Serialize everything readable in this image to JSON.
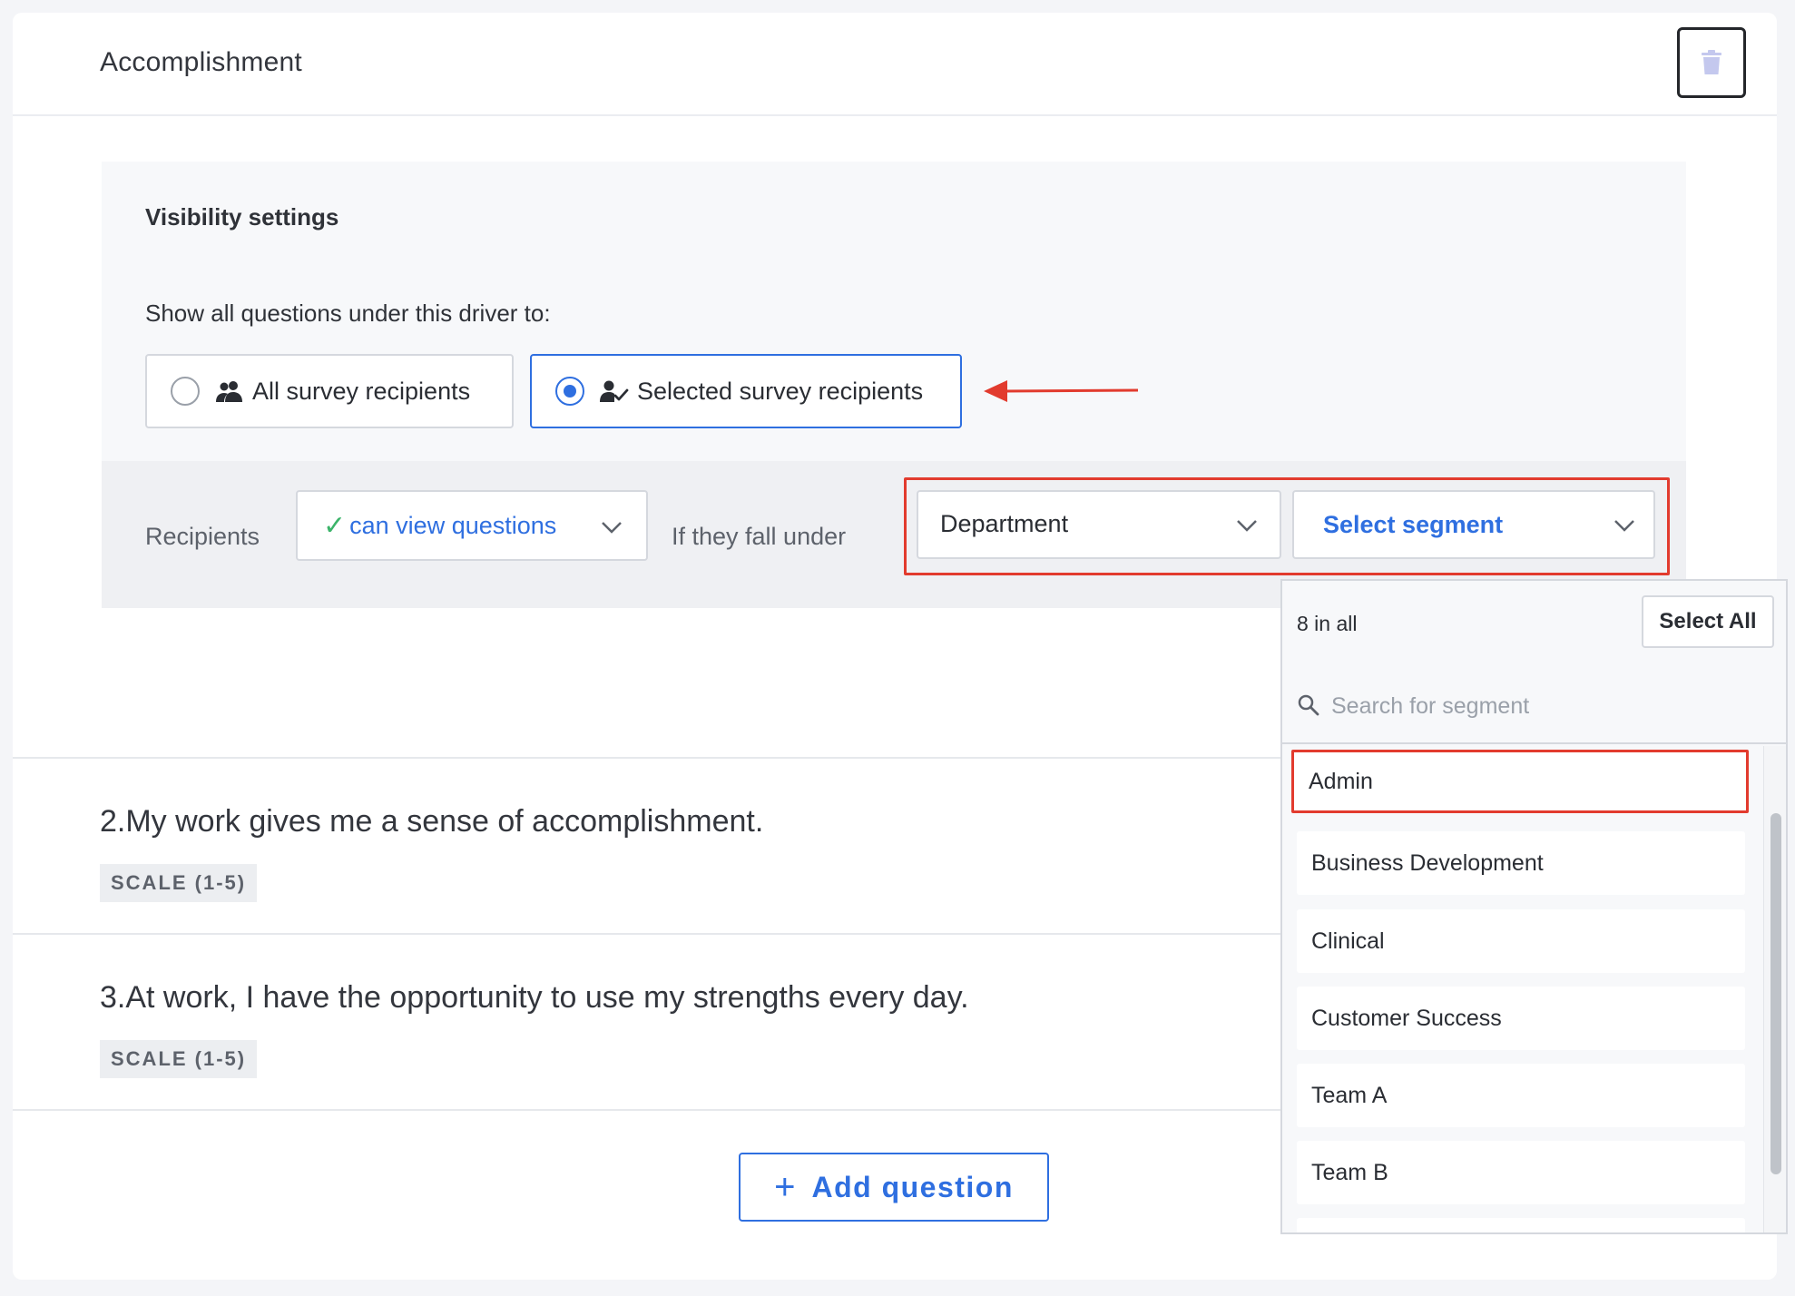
{
  "driver": {
    "title": "Accomplishment"
  },
  "visibility": {
    "title": "Visibility settings",
    "show_label": "Show all questions under this driver to:",
    "options": [
      {
        "label": "All survey recipients",
        "icon": "group-icon",
        "selected": false
      },
      {
        "label": "Selected survey recipients",
        "icon": "person-check-icon",
        "selected": true
      }
    ]
  },
  "rule": {
    "recipients_label": "Recipients",
    "permission_value": "can view questions",
    "fall_under_label": "If they fall under",
    "filter_value": "Department",
    "segment_placeholder": "Select segment"
  },
  "questions": [
    {
      "text": "2.My work gives me a sense of accomplishment.",
      "type": "SCALE (1-5)"
    },
    {
      "text": "3.At work, I have the opportunity to use my strengths every day.",
      "type": "SCALE (1-5)"
    }
  ],
  "add_question": {
    "label": "Add question"
  },
  "segment_dropdown": {
    "count_label": "8 in all",
    "select_all_label": "Select All",
    "search_placeholder": "Search for segment",
    "items": [
      "Admin",
      "Business Development",
      "Clinical",
      "Customer Success",
      "Team A",
      "Team B"
    ],
    "highlighted": "Admin"
  },
  "colors": {
    "accent": "#2f6fe0",
    "annotation": "#e23b2e",
    "check": "#3cb46a"
  }
}
